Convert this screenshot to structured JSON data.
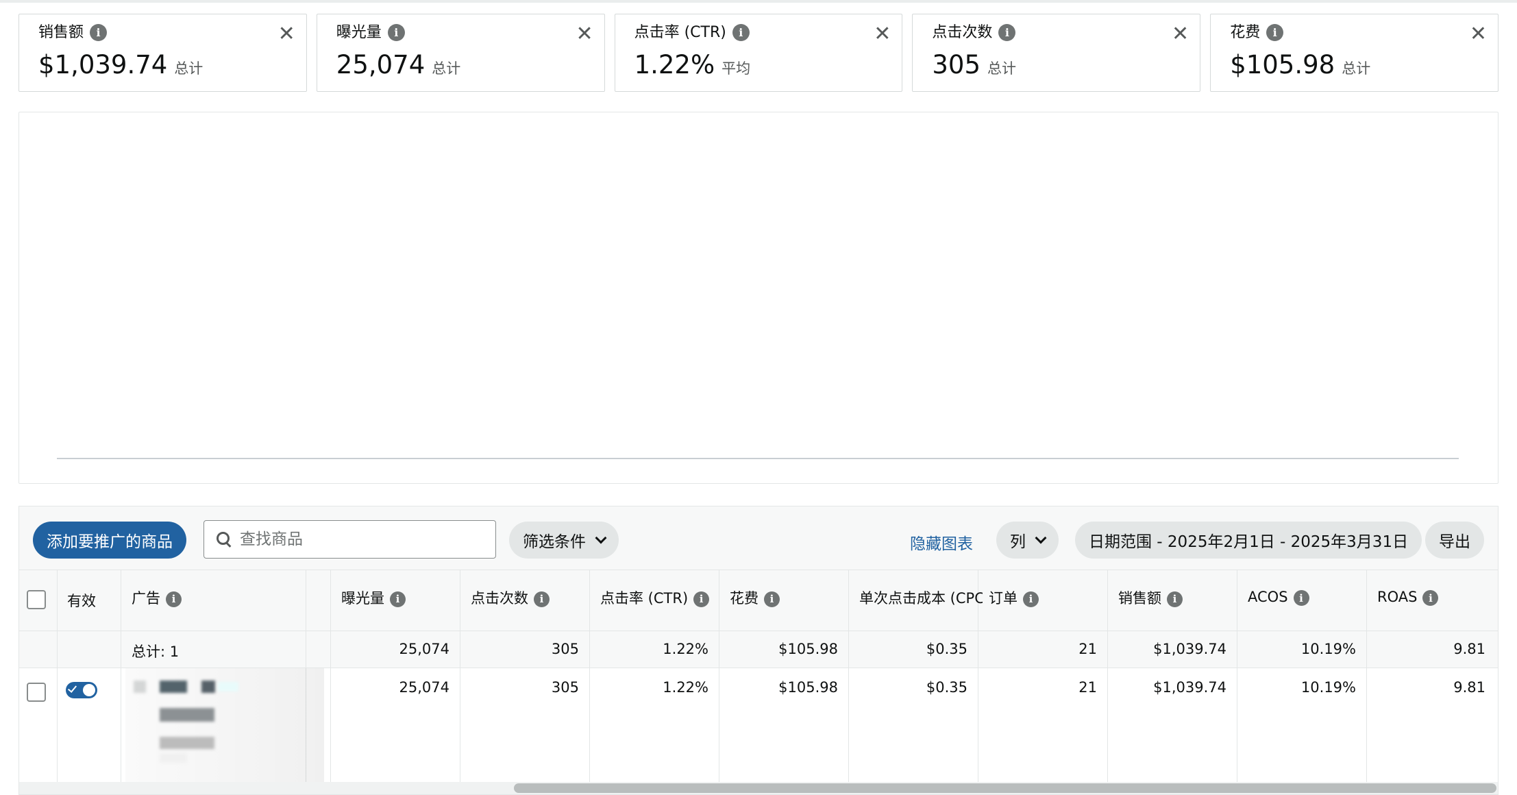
{
  "metrics": [
    {
      "title": "销售额",
      "value": "$1,039.74",
      "unit": "总计"
    },
    {
      "title": "曝光量",
      "value": "25,074",
      "unit": "总计"
    },
    {
      "title": "点击率 (CTR)",
      "value": "1.22%",
      "unit": "平均"
    },
    {
      "title": "点击次数",
      "value": "305",
      "unit": "总计"
    },
    {
      "title": "花费",
      "value": "$105.98",
      "unit": "总计"
    }
  ],
  "close_glyph": "✕",
  "info_glyph": "i",
  "toolbar": {
    "add_button": "添加要推广的商品",
    "search_placeholder": "查找商品",
    "filter_label": "筛选条件",
    "hide_chart_link": "隐藏图表",
    "columns_label": "列",
    "date_range_label": "日期范围 - 2025年2月1日 - 2025年3月31日",
    "export_label": "导出"
  },
  "table": {
    "headers": {
      "active": "有效",
      "ad": "广告",
      "impressions": "曝光量",
      "clicks": "点击次数",
      "ctr": "点击率 (CTR)",
      "spend": "花费",
      "cpc": "单次点击成本 (CPC)",
      "orders": "订单",
      "sales": "销售额",
      "acos": "ACOS",
      "roas": "ROAS"
    },
    "totals": {
      "label": "总计: 1",
      "impressions": "25,074",
      "clicks": "305",
      "ctr": "1.22%",
      "spend": "$105.98",
      "cpc": "$0.35",
      "orders": "21",
      "sales": "$1,039.74",
      "acos": "10.19%",
      "roas": "9.81"
    },
    "rows": [
      {
        "impressions": "25,074",
        "clicks": "305",
        "ctr": "1.22%",
        "spend": "$105.98",
        "cpc": "$0.35",
        "orders": "21",
        "sales": "$1,039.74",
        "acos": "10.19%",
        "roas": "9.81",
        "active": true
      }
    ]
  },
  "colors": {
    "accent": "#2162a1",
    "border": "#d5d9d9",
    "panel": "#f7f8f8"
  }
}
